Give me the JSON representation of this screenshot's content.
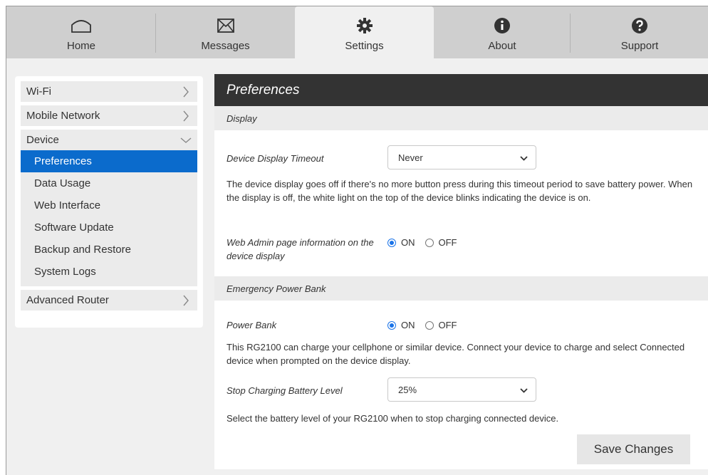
{
  "nav": {
    "tabs": [
      {
        "label": "Home",
        "icon": "home-icon"
      },
      {
        "label": "Messages",
        "icon": "envelope-icon"
      },
      {
        "label": "Settings",
        "icon": "gear-icon"
      },
      {
        "label": "About",
        "icon": "info-icon"
      },
      {
        "label": "Support",
        "icon": "question-icon"
      }
    ],
    "active": "Settings"
  },
  "sidebar": {
    "groups": [
      {
        "label": "Wi-Fi"
      },
      {
        "label": "Mobile Network"
      },
      {
        "label": "Device",
        "items": [
          "Preferences",
          "Data Usage",
          "Web Interface",
          "Software Update",
          "Backup and Restore",
          "System Logs"
        ],
        "active": "Preferences"
      },
      {
        "label": "Advanced Router"
      }
    ]
  },
  "panel": {
    "title": "Preferences",
    "display_section": {
      "title": "Display",
      "timeout_label": "Device Display Timeout",
      "timeout_value": "Never",
      "timeout_desc": "The device display goes off if there's no more button press during this timeout period to save battery power. When the display is off, the white light on the top of the device blinks indicating the device is on.",
      "webadmin_label": "Web Admin page information on the device display",
      "webadmin_on": "ON",
      "webadmin_off": "OFF"
    },
    "power_section": {
      "title": "Emergency Power Bank",
      "powerbank_label": "Power Bank",
      "powerbank_on": "ON",
      "powerbank_off": "OFF",
      "powerbank_desc": "This RG2100 can charge your cellphone or similar device. Connect your device to charge and select Connected device when prompted on the device display.",
      "stop_label": "Stop Charging Battery Level",
      "stop_value": "25%",
      "stop_desc": "Select the battery level of your RG2100 when to stop charging connected device."
    },
    "save_label": "Save Changes"
  },
  "colors": {
    "accent": "#0b6bcc",
    "header_bg": "#333333",
    "nav_bg": "#cfcfcf"
  }
}
